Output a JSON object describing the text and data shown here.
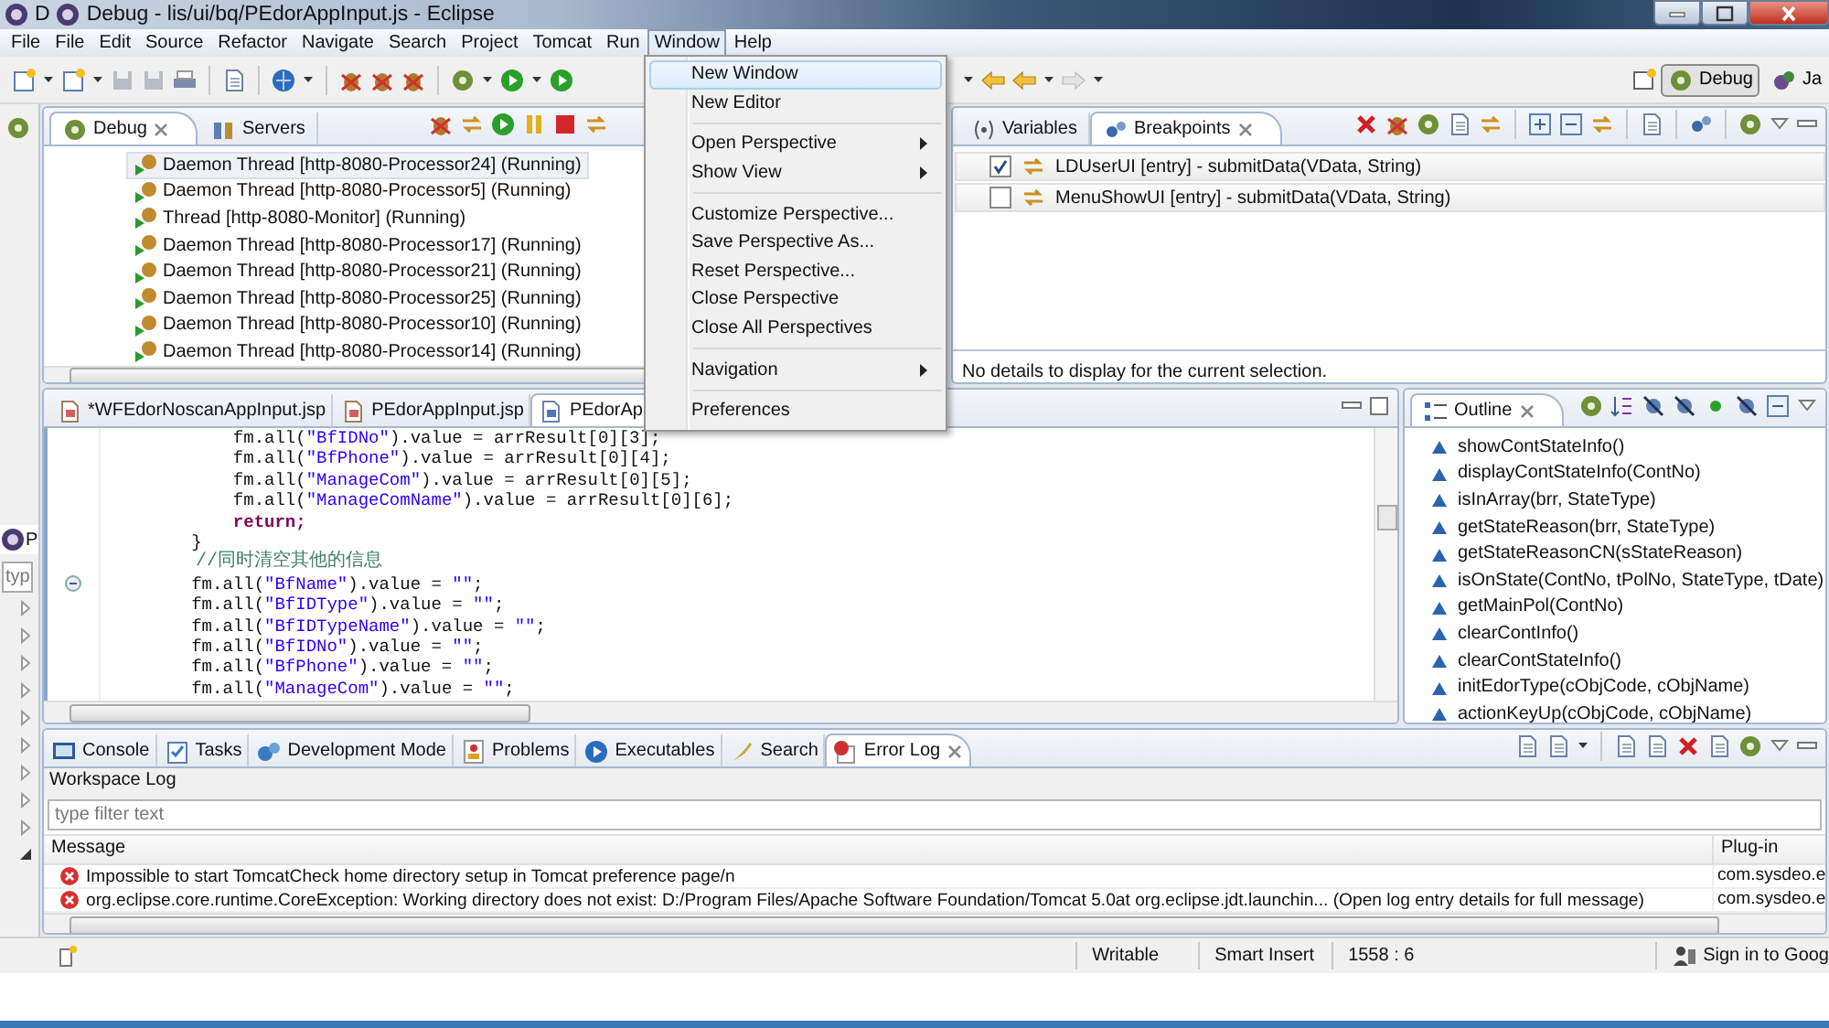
{
  "window": {
    "back_title": "D",
    "title": "Debug - lis/ui/bq/PEdorAppInput.js - Eclipse"
  },
  "menu_bar": [
    {
      "label": "File",
      "selected": false
    },
    {
      "label": "File",
      "selected": false
    },
    {
      "label": "Edit",
      "selected": false
    },
    {
      "label": "Source",
      "selected": false
    },
    {
      "label": "Refactor",
      "selected": false
    },
    {
      "label": "Navigate",
      "selected": false
    },
    {
      "label": "Search",
      "selected": false
    },
    {
      "label": "Project",
      "selected": false
    },
    {
      "label": "Tomcat",
      "selected": false
    },
    {
      "label": "Run",
      "selected": false
    },
    {
      "label": "Window",
      "selected": true
    },
    {
      "label": "Help",
      "selected": false
    }
  ],
  "window_menu": [
    {
      "kind": "item",
      "label": "New Window",
      "selected": true,
      "submenu": false
    },
    {
      "kind": "item",
      "label": "New Editor",
      "selected": false,
      "submenu": false
    },
    {
      "kind": "separator"
    },
    {
      "kind": "item",
      "label": "Open Perspective",
      "selected": false,
      "submenu": true
    },
    {
      "kind": "item",
      "label": "Show View",
      "selected": false,
      "submenu": true
    },
    {
      "kind": "separator"
    },
    {
      "kind": "item",
      "label": "Customize Perspective...",
      "selected": false,
      "submenu": false
    },
    {
      "kind": "item",
      "label": "Save Perspective As...",
      "selected": false,
      "submenu": false
    },
    {
      "kind": "item",
      "label": "Reset Perspective...",
      "selected": false,
      "submenu": false
    },
    {
      "kind": "item",
      "label": "Close Perspective",
      "selected": false,
      "submenu": false
    },
    {
      "kind": "item",
      "label": "Close All Perspectives",
      "selected": false,
      "submenu": false
    },
    {
      "kind": "separator"
    },
    {
      "kind": "item",
      "label": "Navigation",
      "selected": false,
      "submenu": true
    },
    {
      "kind": "separator"
    },
    {
      "kind": "item",
      "label": "Preferences",
      "selected": false,
      "submenu": false
    }
  ],
  "perspectives": [
    {
      "label": "Debug",
      "selected": true
    },
    {
      "label": "Ja",
      "selected": false
    }
  ],
  "left_view": {
    "title": "P",
    "placeholder": "typ"
  },
  "debug_view": {
    "tabs": [
      {
        "label": "Debug",
        "selected": true
      },
      {
        "label": "Servers",
        "selected": false
      }
    ],
    "threads": [
      {
        "label": "Daemon Thread [http-8080-Processor24] (Running)",
        "selected": true
      },
      {
        "label": "Daemon Thread [http-8080-Processor5] (Running)",
        "selected": false
      },
      {
        "label": "Thread [http-8080-Monitor] (Running)",
        "selected": false
      },
      {
        "label": "Daemon Thread [http-8080-Processor17] (Running)",
        "selected": false
      },
      {
        "label": "Daemon Thread [http-8080-Processor21] (Running)",
        "selected": false
      },
      {
        "label": "Daemon Thread [http-8080-Processor25] (Running)",
        "selected": false
      },
      {
        "label": "Daemon Thread [http-8080-Processor10] (Running)",
        "selected": false
      },
      {
        "label": "Daemon Thread [http-8080-Processor14] (Running)",
        "selected": false
      }
    ]
  },
  "breakpoints_view": {
    "tabs": [
      {
        "label": "Variables",
        "selected": false
      },
      {
        "label": "Breakpoints",
        "selected": true
      }
    ],
    "breakpoints": [
      {
        "label": "LDUserUI [entry] - submitData(VData, String)",
        "checked": true
      },
      {
        "label": "MenuShowUI [entry] - submitData(VData, String)",
        "checked": false
      }
    ],
    "details": "No details to display for the current selection."
  },
  "editor": {
    "tabs": [
      {
        "label": "*WFEdorNoscanAppInput.jsp",
        "selected": false
      },
      {
        "label": "PEdorAppInput.jsp",
        "selected": false
      },
      {
        "label": "PEdorAp",
        "selected": true
      }
    ],
    "lines": [
      {
        "kind": "code",
        "text": "            fm.all(\"BfIDNo\").value = arrResult[0][3];",
        "fold": false
      },
      {
        "kind": "code",
        "text": "            fm.all(\"BfPhone\").value = arrResult[0][4];",
        "fold": false
      },
      {
        "kind": "code",
        "text": "            fm.all(\"ManageCom\").value = arrResult[0][5];",
        "fold": false
      },
      {
        "kind": "code",
        "text": "            fm.all(\"ManageComName\").value = arrResult[0][6];",
        "fold": false
      },
      {
        "kind": "keyword",
        "text": "            return;",
        "fold": false
      },
      {
        "kind": "code",
        "text": "        }",
        "fold": false
      },
      {
        "kind": "comment",
        "text": "        //同时清空其他的信息",
        "fold": false
      },
      {
        "kind": "code",
        "text": "        fm.all(\"BfName\").value = \"\";",
        "fold": true
      },
      {
        "kind": "code",
        "text": "        fm.all(\"BfIDType\").value = \"\";",
        "fold": false
      },
      {
        "kind": "code",
        "text": "        fm.all(\"BfIDTypeName\").value = \"\";",
        "fold": false
      },
      {
        "kind": "code",
        "text": "        fm.all(\"BfIDNo\").value = \"\";",
        "fold": false
      },
      {
        "kind": "code",
        "text": "        fm.all(\"BfPhone\").value = \"\";",
        "fold": false
      },
      {
        "kind": "code",
        "text": "        fm.all(\"ManageCom\").value = \"\";",
        "fold": false
      }
    ]
  },
  "outline": {
    "tabs": [
      {
        "label": "Outline",
        "selected": true
      }
    ],
    "items": [
      "showContStateInfo()",
      "displayContStateInfo(ContNo)",
      "isInArray(brr, StateType)",
      "getStateReason(brr, StateType)",
      "getStateReasonCN(sStateReason)",
      "isOnState(ContNo, tPolNo, StateType, tDate)",
      "getMainPol(ContNo)",
      "clearContInfo()",
      "clearContStateInfo()",
      "initEdorType(cObjCode, cObjName)",
      "actionKeyUp(cObjCode, cObjName)"
    ]
  },
  "bottom_view": {
    "tabs": [
      {
        "label": "Console",
        "selected": false
      },
      {
        "label": "Tasks",
        "selected": false
      },
      {
        "label": "Development Mode",
        "selected": false
      },
      {
        "label": "Problems",
        "selected": false
      },
      {
        "label": "Executables",
        "selected": false
      },
      {
        "label": "Search",
        "selected": false
      },
      {
        "label": "Error Log",
        "selected": true
      }
    ],
    "title": "Workspace Log",
    "filter_placeholder": "type filter text",
    "columns": [
      "Message",
      "Plug-in"
    ],
    "rows": [
      {
        "message": "Impossible to start TomcatCheck home directory setup in Tomcat preference page/n",
        "plugin": "com.sysdeo.e"
      },
      {
        "message": "org.eclipse.core.runtime.CoreException: Working directory does not exist: D:/Program Files/Apache Software Foundation/Tomcat 5.0at org.eclipse.jdt.launchin... (Open log entry details for full message)",
        "plugin": "com.sysdeo.e"
      }
    ]
  },
  "status_bar": {
    "fields": [
      "Writable",
      "Smart Insert",
      "1558 : 6"
    ],
    "sign_in": "Sign in to Goog"
  }
}
